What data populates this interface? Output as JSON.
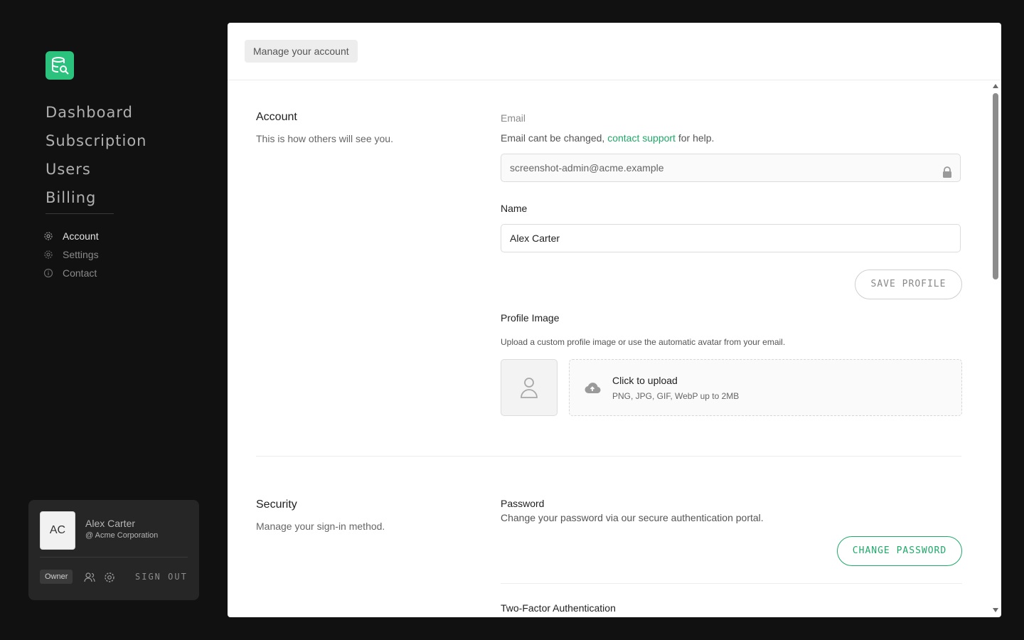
{
  "sidebar": {
    "main_nav": [
      {
        "label": "Dashboard"
      },
      {
        "label": "Subscription"
      },
      {
        "label": "Users"
      },
      {
        "label": "Billing"
      }
    ],
    "sub_nav": [
      {
        "label": "Account",
        "icon": "gear-icon",
        "active": true
      },
      {
        "label": "Settings",
        "icon": "gear-icon",
        "active": false
      },
      {
        "label": "Contact",
        "icon": "info-icon",
        "active": false
      }
    ]
  },
  "user_card": {
    "initials": "AC",
    "name": "Alex Carter",
    "org": "@ Acme Corporation",
    "role": "Owner",
    "sign_out": "SIGN OUT"
  },
  "header": {
    "crumb": "Manage your account"
  },
  "account": {
    "title": "Account",
    "subtitle": "This is how others will see you.",
    "email_label": "Email",
    "email_help_prefix": "Email cant be changed,",
    "email_help_link": "contact support",
    "email_help_suffix": "for help.",
    "email_value": "screenshot-admin@acme.example",
    "name_label": "Name",
    "name_value": "Alex Carter",
    "save_button": "SAVE PROFILE",
    "profile_image_label": "Profile Image",
    "profile_image_help": "Upload a custom profile image or use the automatic avatar from your email.",
    "upload_title": "Click to upload",
    "upload_sub": "PNG, JPG, GIF, WebP up to 2MB"
  },
  "security": {
    "title": "Security",
    "subtitle": "Manage your sign-in method.",
    "password_label": "Password",
    "password_help": "Change your password via our secure authentication portal.",
    "change_password_button": "CHANGE PASSWORD",
    "two_factor_label": "Two-Factor Authentication"
  },
  "colors": {
    "brand": "#2bc27e",
    "link": "#1fa968",
    "background": "#111111"
  }
}
